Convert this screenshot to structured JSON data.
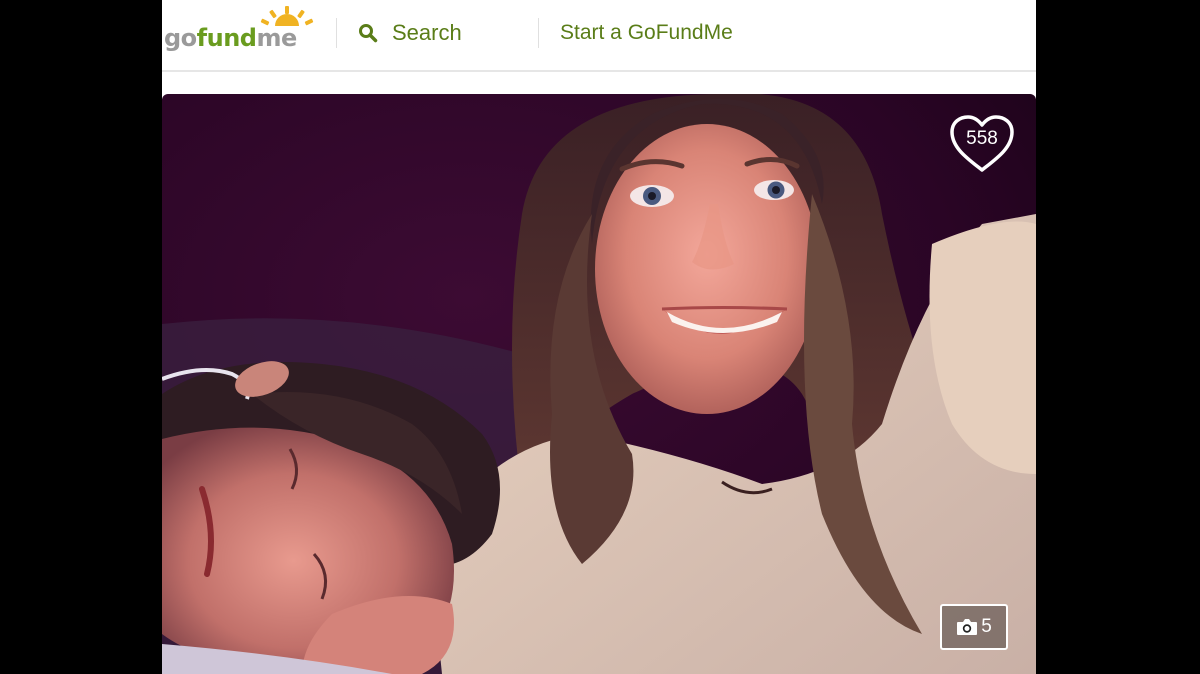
{
  "header": {
    "logo": {
      "go": "go",
      "fund": "fund",
      "me": "me"
    },
    "search_label": "Search",
    "start_label": "Start a GoFundMe"
  },
  "campaign_photo": {
    "hearts_count": "558",
    "photo_count": "5"
  },
  "colors": {
    "brand_green": "#5a7d18",
    "logo_gray": "#9a9a9a",
    "logo_sun": "#f0b323"
  },
  "icons": {
    "search": "search-icon",
    "heart": "heart-icon",
    "camera": "camera-icon",
    "logo_sun": "sun-icon"
  }
}
